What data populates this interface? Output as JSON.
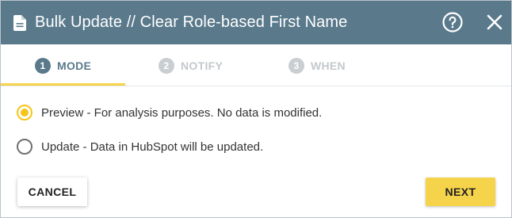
{
  "dialog": {
    "title": "Bulk Update // Clear Role-based First Name",
    "icons": {
      "title": "document-icon",
      "help": "help-icon",
      "close": "close-icon"
    },
    "colors": {
      "header": "#5a7a8c",
      "accent": "#f5d34a",
      "radio_selected": "#f5c518"
    }
  },
  "tabs": [
    {
      "number": "1",
      "label": "MODE",
      "active": true
    },
    {
      "number": "2",
      "label": "NOTIFY",
      "active": false
    },
    {
      "number": "3",
      "label": "WHEN",
      "active": false
    }
  ],
  "options": [
    {
      "label": "Preview - For analysis purposes. No data is modified.",
      "selected": true
    },
    {
      "label": "Update - Data in HubSpot will be updated.",
      "selected": false
    }
  ],
  "buttons": {
    "cancel": "CANCEL",
    "next": "NEXT"
  }
}
